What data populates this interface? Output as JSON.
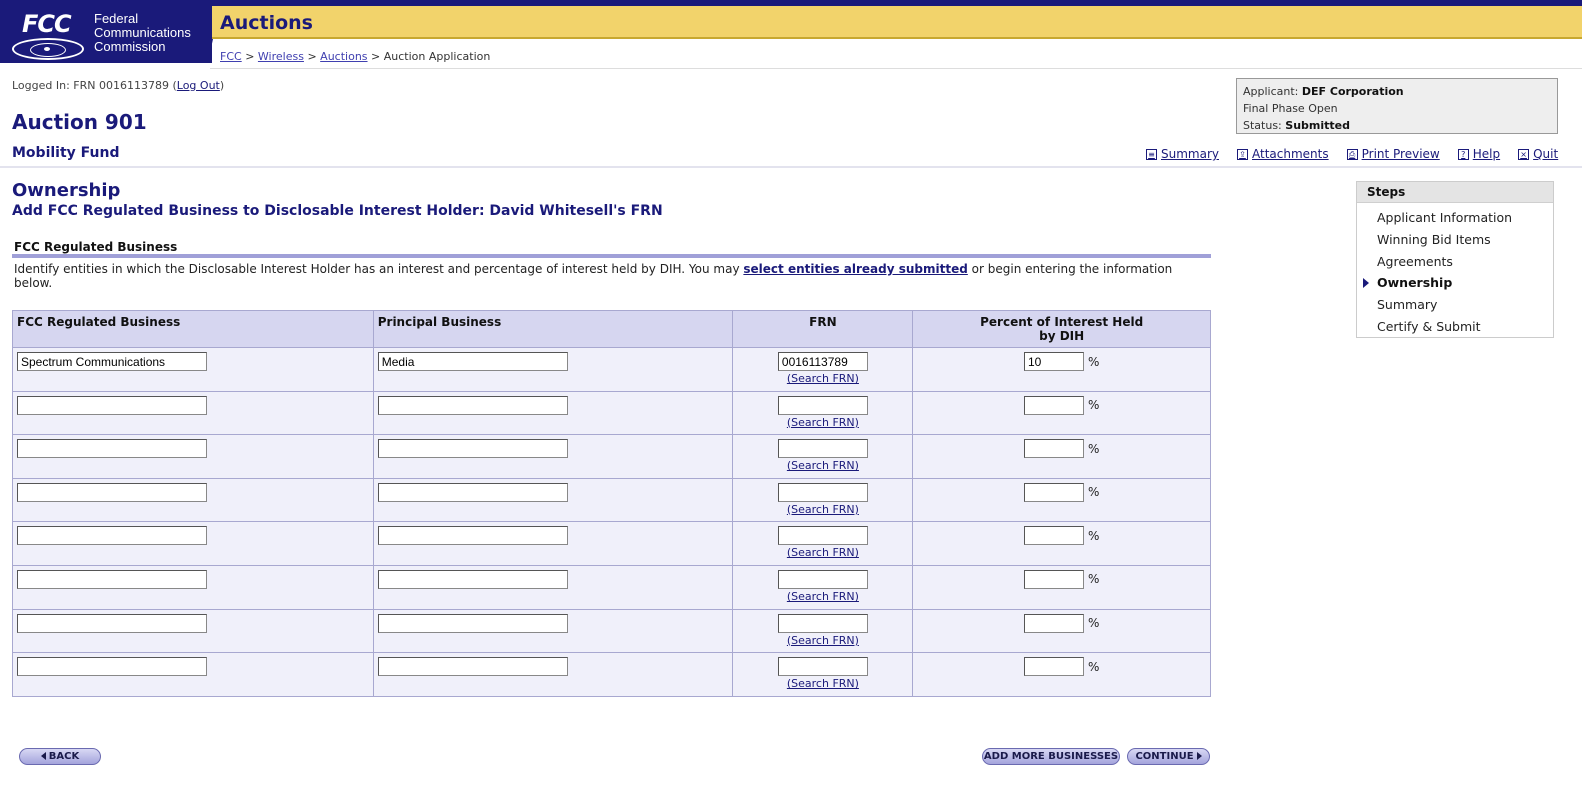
{
  "header": {
    "logo": {
      "abbr": "FCC",
      "line1": "Federal",
      "line2": "Communications",
      "line3": "Commission"
    },
    "section_title": "Auctions",
    "breadcrumb": {
      "fcc": "FCC",
      "sep": ">",
      "wireless": "Wireless",
      "auctions": "Auctions",
      "current": "Auction Application"
    }
  },
  "session": {
    "logged_prefix": "Logged In: FRN 0016113789 (",
    "logout": "Log Out",
    "logged_suffix": ")"
  },
  "auction": {
    "title": "Auction 901",
    "subtitle": "Mobility Fund"
  },
  "applicant": {
    "applicant_label": "Applicant:",
    "applicant_value": "DEF Corporation",
    "phase": "Final Phase Open",
    "status_label": "Status:",
    "status_value": "Submitted"
  },
  "toolbar": {
    "summary": "Summary",
    "attachments": "Attachments",
    "print_preview": "Print Preview",
    "help": "Help",
    "quit": "Quit"
  },
  "page": {
    "heading": "Ownership",
    "subheading": "Add FCC Regulated Business to Disclosable Interest Holder: David Whitesell's FRN",
    "section_label": "FCC Regulated Business",
    "instructions_pre": "Identify entities in which the Disclosable Interest Holder has an interest and percentage of interest held by DIH. You may ",
    "instructions_link": "select entities already submitted",
    "instructions_post": " or begin entering the information below."
  },
  "table": {
    "headers": {
      "business": "FCC Regulated Business",
      "principal": "Principal Business",
      "frn": "FRN",
      "percent_line1": "Percent of Interest Held",
      "percent_line2": "by DIH"
    },
    "search_link": "(Search FRN)",
    "pct_symbol": "%",
    "rows": [
      {
        "business": "Spectrum Communications",
        "principal": "Media",
        "frn": "0016113789",
        "percent": "10"
      },
      {
        "business": "",
        "principal": "",
        "frn": "",
        "percent": ""
      },
      {
        "business": "",
        "principal": "",
        "frn": "",
        "percent": ""
      },
      {
        "business": "",
        "principal": "",
        "frn": "",
        "percent": ""
      },
      {
        "business": "",
        "principal": "",
        "frn": "",
        "percent": ""
      },
      {
        "business": "",
        "principal": "",
        "frn": "",
        "percent": ""
      },
      {
        "business": "",
        "principal": "",
        "frn": "",
        "percent": ""
      },
      {
        "business": "",
        "principal": "",
        "frn": "",
        "percent": ""
      }
    ]
  },
  "steps": {
    "title": "Steps",
    "items": [
      "Applicant Information",
      "Winning Bid Items",
      "Agreements",
      "Ownership",
      "Summary",
      "Certify & Submit"
    ],
    "active_index": 3
  },
  "buttons": {
    "back": "BACK",
    "add_more": "ADD MORE BUSINESSES",
    "continue": "CONTINUE"
  },
  "colors": {
    "brand_navy": "#1a1a7a",
    "header_yellow": "#f2d36b",
    "table_header": "#d6d6f0",
    "table_cell": "#f0f0fa"
  }
}
